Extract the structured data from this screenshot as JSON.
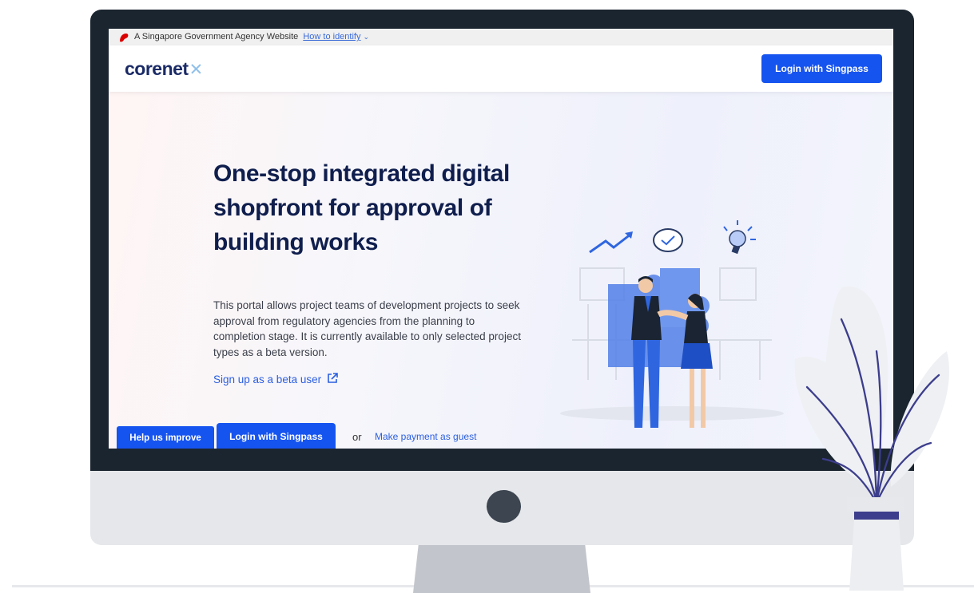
{
  "gov_banner": {
    "text": "A Singapore Government Agency Website",
    "link": "How to identify"
  },
  "header": {
    "logo_primary": "corenet",
    "login_button": "Login with Singpass"
  },
  "hero": {
    "title": "One-stop integrated digital shopfront for approval of building works",
    "description": "This portal allows project teams of development projects to seek approval from regulatory agencies from the planning to completion stage. It is currently available to only selected project types as a beta version.",
    "signup_link": "Sign up as a beta user",
    "login_button": "Login with Singpass",
    "or": "or",
    "guest_link": "Make payment as guest"
  },
  "feedback": {
    "help_button": "Help us improve"
  },
  "colors": {
    "primary_button": "#1654f0",
    "link": "#2a5ee0",
    "heading": "#0f1e4d",
    "monitor_frame": "#1b2530"
  },
  "icons": [
    "lion-head-icon",
    "chevron-down-icon",
    "external-link-icon"
  ]
}
